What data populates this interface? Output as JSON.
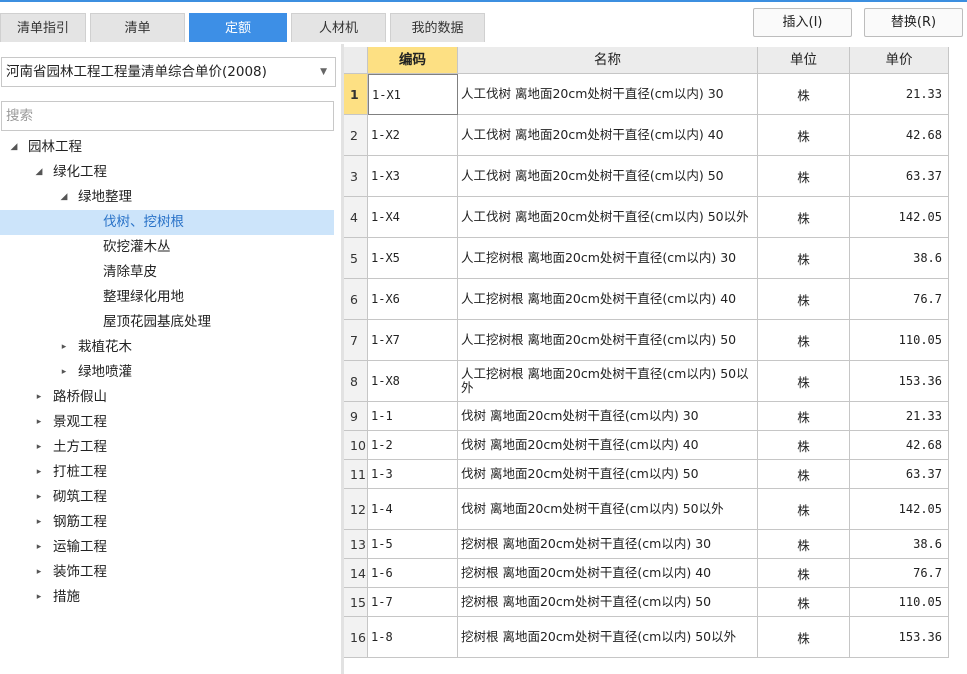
{
  "tabs": [
    {
      "label": "清单指引"
    },
    {
      "label": "清单"
    },
    {
      "label": "定额",
      "active": true
    },
    {
      "label": "人材机"
    },
    {
      "label": "我的数据"
    }
  ],
  "actions": {
    "insert": "插入(I)",
    "replace": "替换(R)"
  },
  "library": {
    "selected": "河南省园林工程工程量清单综合单价(2008)"
  },
  "search": {
    "placeholder": "搜索"
  },
  "tree": [
    {
      "label": "园林工程",
      "level": 0,
      "state": "expanded"
    },
    {
      "label": "绿化工程",
      "level": 1,
      "state": "expanded"
    },
    {
      "label": "绿地整理",
      "level": 2,
      "state": "expanded"
    },
    {
      "label": "伐树、挖树根",
      "level": 3,
      "state": "leaf",
      "selected": true
    },
    {
      "label": "砍挖灌木丛",
      "level": 3,
      "state": "leaf"
    },
    {
      "label": "清除草皮",
      "level": 3,
      "state": "leaf"
    },
    {
      "label": "整理绿化用地",
      "level": 3,
      "state": "leaf"
    },
    {
      "label": "屋顶花园基底处理",
      "level": 3,
      "state": "leaf"
    },
    {
      "label": "栽植花木",
      "level": 2,
      "state": "collapsed"
    },
    {
      "label": "绿地喷灌",
      "level": 2,
      "state": "collapsed"
    },
    {
      "label": "路桥假山",
      "level": 1,
      "state": "collapsed"
    },
    {
      "label": "景观工程",
      "level": 1,
      "state": "collapsed"
    },
    {
      "label": "土方工程",
      "level": 1,
      "state": "collapsed"
    },
    {
      "label": "打桩工程",
      "level": 1,
      "state": "collapsed"
    },
    {
      "label": "砌筑工程",
      "level": 1,
      "state": "collapsed"
    },
    {
      "label": "钢筋工程",
      "level": 1,
      "state": "collapsed"
    },
    {
      "label": "运输工程",
      "level": 1,
      "state": "collapsed"
    },
    {
      "label": "装饰工程",
      "level": 1,
      "state": "collapsed"
    },
    {
      "label": "措施",
      "level": 1,
      "state": "collapsed"
    }
  ],
  "table": {
    "headers": {
      "index": "",
      "code": "编码",
      "name": "名称",
      "unit": "单位",
      "price": "单价"
    },
    "rows": [
      {
        "idx": "1",
        "code": "1-X1",
        "name": "人工伐树 离地面20cm处树干直径(cm以内) 30",
        "unit": "株",
        "price": "21.33"
      },
      {
        "idx": "2",
        "code": "1-X2",
        "name": "人工伐树 离地面20cm处树干直径(cm以内) 40",
        "unit": "株",
        "price": "42.68"
      },
      {
        "idx": "3",
        "code": "1-X3",
        "name": "人工伐树 离地面20cm处树干直径(cm以内) 50",
        "unit": "株",
        "price": "63.37"
      },
      {
        "idx": "4",
        "code": "1-X4",
        "name": "人工伐树 离地面20cm处树干直径(cm以内) 50以外",
        "unit": "株",
        "price": "142.05"
      },
      {
        "idx": "5",
        "code": "1-X5",
        "name": "人工挖树根 离地面20cm处树干直径(cm以内) 30",
        "unit": "株",
        "price": "38.6"
      },
      {
        "idx": "6",
        "code": "1-X6",
        "name": "人工挖树根 离地面20cm处树干直径(cm以内) 40",
        "unit": "株",
        "price": "76.7"
      },
      {
        "idx": "7",
        "code": "1-X7",
        "name": "人工挖树根 离地面20cm处树干直径(cm以内) 50",
        "unit": "株",
        "price": "110.05"
      },
      {
        "idx": "8",
        "code": "1-X8",
        "name": "人工挖树根 离地面20cm处树干直径(cm以内) 50以外",
        "unit": "株",
        "price": "153.36"
      },
      {
        "idx": "9",
        "code": "1-1",
        "name": "伐树 离地面20cm处树干直径(cm以内) 30",
        "unit": "株",
        "price": "21.33"
      },
      {
        "idx": "10",
        "code": "1-2",
        "name": "伐树 离地面20cm处树干直径(cm以内) 40",
        "unit": "株",
        "price": "42.68"
      },
      {
        "idx": "11",
        "code": "1-3",
        "name": "伐树 离地面20cm处树干直径(cm以内) 50",
        "unit": "株",
        "price": "63.37"
      },
      {
        "idx": "12",
        "code": "1-4",
        "name": "伐树 离地面20cm处树干直径(cm以内) 50以外",
        "unit": "株",
        "price": "142.05"
      },
      {
        "idx": "13",
        "code": "1-5",
        "name": "挖树根 离地面20cm处树干直径(cm以内) 30",
        "unit": "株",
        "price": "38.6"
      },
      {
        "idx": "14",
        "code": "1-6",
        "name": "挖树根 离地面20cm处树干直径(cm以内) 40",
        "unit": "株",
        "price": "76.7"
      },
      {
        "idx": "15",
        "code": "1-7",
        "name": "挖树根 离地面20cm处树干直径(cm以内) 50",
        "unit": "株",
        "price": "110.05"
      },
      {
        "idx": "16",
        "code": "1-8",
        "name": "挖树根 离地面20cm处树干直径(cm以内) 50以外",
        "unit": "株",
        "price": "153.36"
      }
    ]
  }
}
